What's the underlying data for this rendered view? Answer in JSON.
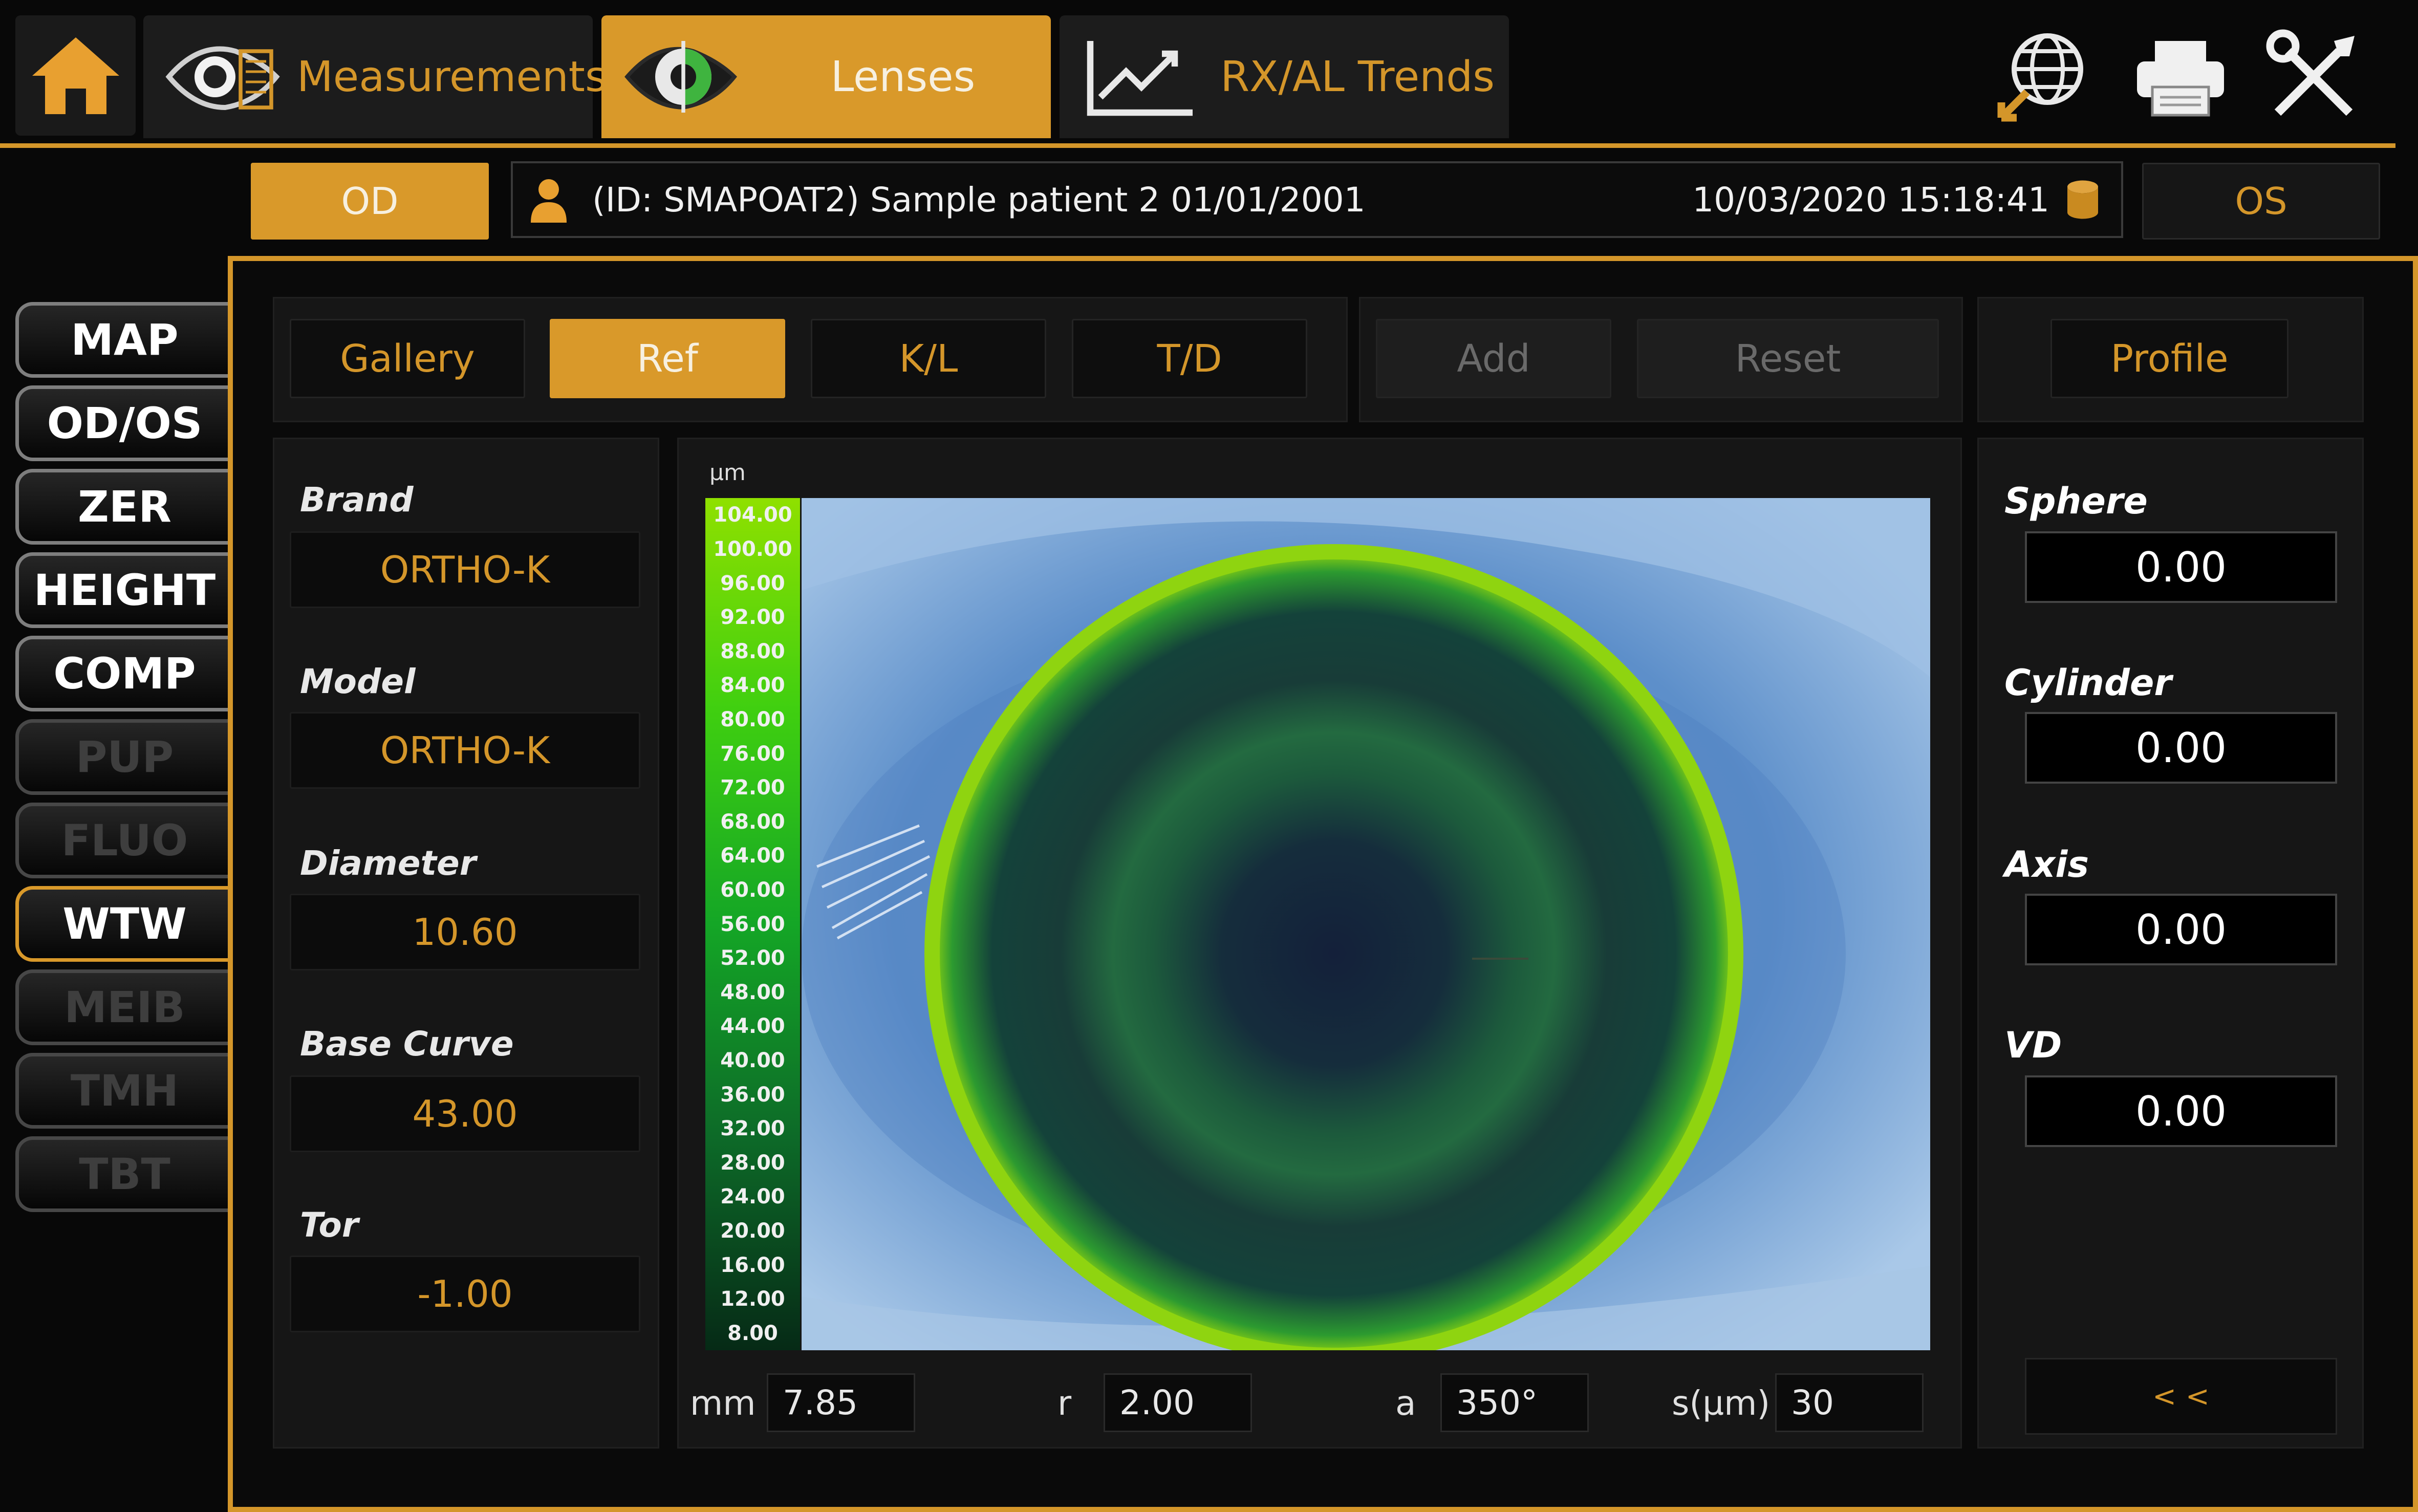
{
  "top_tabs": {
    "measurements": "Measurements",
    "lenses": "Lenses",
    "trends": "RX/AL Trends"
  },
  "patient_bar": {
    "od": "OD",
    "os": "OS",
    "patient": "(ID: SMAPOAT2) Sample patient 2 01/01/2001",
    "datetime": "10/03/2020 15:18:41"
  },
  "left_nav": [
    "MAP",
    "OD/OS",
    "ZER",
    "HEIGHT",
    "COMP",
    "PUP",
    "FLUO",
    "WTW",
    "MEIB",
    "TMH",
    "TBT"
  ],
  "toolbar": {
    "gallery": "Gallery",
    "ref": "Ref",
    "kl": "K/L",
    "td": "T/D",
    "add": "Add",
    "reset": "Reset",
    "profile": "Profile"
  },
  "lens_params": {
    "brand_label": "Brand",
    "brand": "ORTHO-K",
    "model_label": "Model",
    "model": "ORTHO-K",
    "diameter_label": "Diameter",
    "diameter": "10.60",
    "base_curve_label": "Base Curve",
    "base_curve": "43.00",
    "tor_label": "Tor",
    "tor": "-1.00"
  },
  "map": {
    "unit": "µm",
    "scale": [
      "104.00",
      "100.00",
      "96.00",
      "92.00",
      "88.00",
      "84.00",
      "80.00",
      "76.00",
      "72.00",
      "68.00",
      "64.00",
      "60.00",
      "56.00",
      "52.00",
      "48.00",
      "44.00",
      "40.00",
      "36.00",
      "32.00",
      "28.00",
      "24.00",
      "20.00",
      "16.00",
      "12.00",
      "8.00"
    ],
    "readouts": {
      "mm_label": "mm",
      "mm": "7.85",
      "r_label": "r",
      "r": "2.00",
      "a_label": "a",
      "a": "350°",
      "s_label": "s(µm)",
      "s": "30"
    }
  },
  "refraction": {
    "sphere_label": "Sphere",
    "sphere": "0.00",
    "cylinder_label": "Cylinder",
    "cylinder": "0.00",
    "axis_label": "Axis",
    "axis": "0.00",
    "vd_label": "VD",
    "vd": "0.00",
    "collapse": "< <"
  },
  "colors": {
    "accent": "#d9992a",
    "background": "#080808",
    "panel": "#161616"
  }
}
